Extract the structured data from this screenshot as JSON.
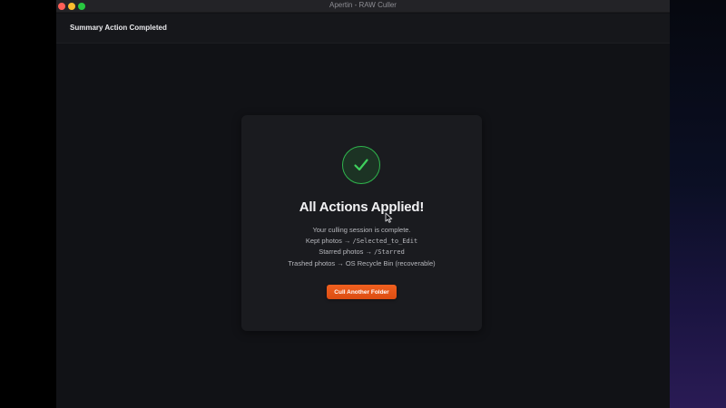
{
  "window": {
    "title": "Apertin - RAW Culler"
  },
  "header": {
    "title": "Summary Action Completed"
  },
  "summary": {
    "title": "All Actions Applied!",
    "session_text": "Your culling session is complete.",
    "kept_label": "Kept photos →",
    "kept_path": "/Selected_to_Edit",
    "starred_label": "Starred photos →",
    "starred_path": "/Starred",
    "trashed_text": "Trashed photos → OS Recycle Bin (recoverable)",
    "button_label": "Cull Another Folder",
    "icon": "checkmark-icon"
  },
  "colors": {
    "accent": "#e8581a",
    "success": "#2fb64d",
    "background": "#111216",
    "card": "#1a1b1f"
  }
}
